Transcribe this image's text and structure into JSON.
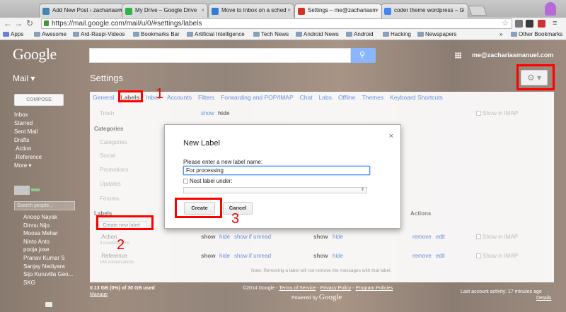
{
  "browser": {
    "tabs": [
      {
        "label": "Add New Post ‹ zachariasm",
        "favicon_color": "#3e88b6"
      },
      {
        "label": "My Drive – Google Drive",
        "favicon_color": "#2eb24a"
      },
      {
        "label": "Move to Inbox on a sched",
        "favicon_color": "#2f7dd8"
      },
      {
        "label": "Settings – me@zachariasm",
        "favicon_color": "#d93025"
      },
      {
        "label": "coder theme wordpress – G",
        "favicon_color": "#4285f4"
      }
    ],
    "url": "https://mail.google.com/mail/u/0/#settings/labels",
    "bookmarks": [
      "Apps",
      "Awesome",
      "Ard-Raspi-Videos",
      "Bookmarks Bar",
      "Artificial Intelligence",
      "Tech News",
      "Android News",
      "Android",
      "Hacking",
      "Newspapers",
      "Other Bookmarks"
    ],
    "overflow": "»"
  },
  "gmail": {
    "logo": "Google",
    "account": "me@zachariasmanuel.com",
    "mail_label": "Mail ▾",
    "compose": "COMPOSE",
    "nav": [
      "Inbox",
      "Starred",
      "Sent Mail",
      "Drafts",
      ".Action",
      ".Reference",
      "More ▾"
    ],
    "search_people": "Search people...",
    "contacts": [
      "Anoop Nayak",
      "Dinnu Nijo",
      "Moosa Mehar",
      "Ninto Anto",
      "pooja jose",
      "Pranav Kumar S",
      "Sanjay Nediyara",
      "Sijo Kuruvilla Geo...",
      "SKG"
    ],
    "accent": "#4d90fe"
  },
  "settings": {
    "title": "Settings",
    "tabs": [
      "General",
      "Labels",
      "Inbox",
      "Accounts",
      "Filters",
      "Forwarding and POP/IMAP",
      "Chat",
      "Labs",
      "Offline",
      "Themes",
      "Keyboard Shortcuts"
    ],
    "active_tab": "Labels",
    "trash": {
      "name": "Trash",
      "show": "show",
      "hide": "hide",
      "imap": "Show in IMAP"
    },
    "categories_heading": "Categories",
    "categories": [
      "Categories",
      "Social",
      "Promotions",
      "Updates",
      "Forums"
    ],
    "labels_heading": "Labels",
    "create_label": "Create new label",
    "actions_heading": "Actions",
    "user_labels": [
      {
        "name": ".Action",
        "count": "3 conversations",
        "show": "show",
        "hide": "hide",
        "show_if_unread": "show if unread",
        "msg_show": "show",
        "msg_hide": "hide",
        "remove": "remove",
        "edit": "edit",
        "imap": "Show in IMAP"
      },
      {
        "name": ".Reference",
        "count": "163 conversations",
        "show": "show",
        "hide": "hide",
        "show_if_unread": "show if unread",
        "msg_show": "show",
        "msg_hide": "hide",
        "remove": "remove",
        "edit": "edit",
        "imap": "Show in IMAP"
      }
    ],
    "note": "Note: Removing a label will not remove the messages with that label.",
    "storage": "0.13 GB (0%) of 30 GB used",
    "manage": "Manage",
    "copyright": "©2014 Google - ",
    "terms": "Terms of Service",
    "privacy": "Privacy Policy",
    "program": "Program Policies",
    "powered": "Powered by",
    "powered_google": "Google",
    "last_activity": "Last account activity: 17 minutes ago",
    "details": "Details"
  },
  "dialog": {
    "title": "New Label",
    "close": "×",
    "prompt": "Please enter a new label name:",
    "value": "For processing",
    "nest": "Nest label under:",
    "create": "Create",
    "cancel": "Cancel"
  },
  "annotations": {
    "one": "1",
    "two": "2",
    "three": "3",
    "color": "#ff0000"
  }
}
